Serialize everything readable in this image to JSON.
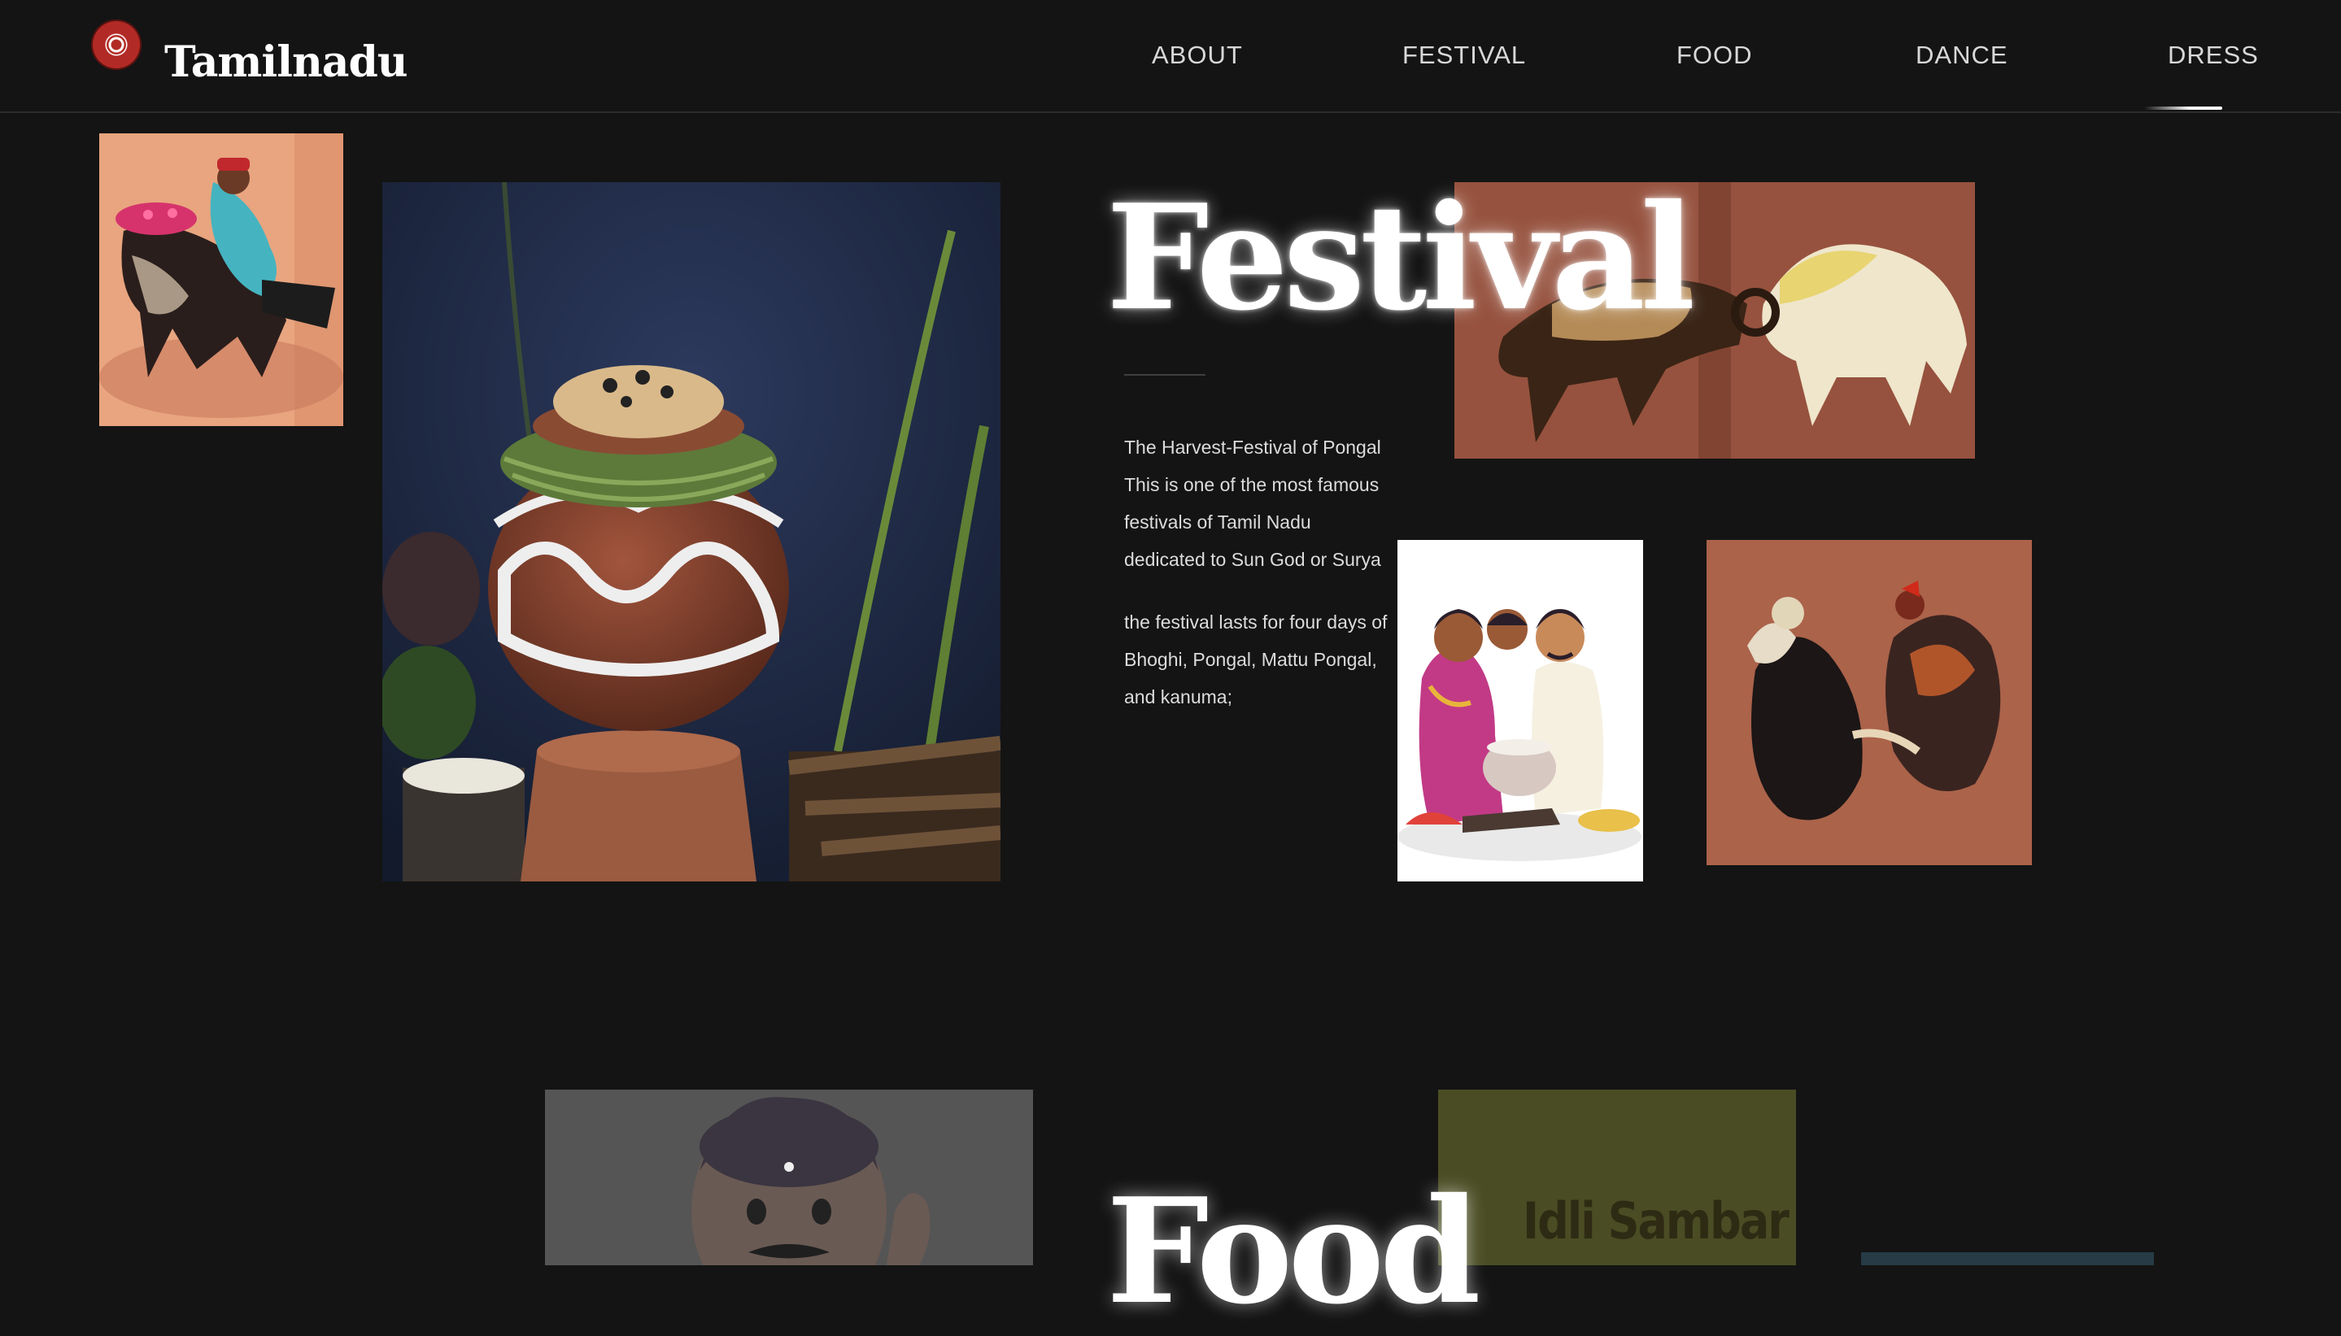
{
  "header": {
    "brand": "Tamilnadu",
    "logo_icon": "emblem-icon",
    "nav": [
      "ABOUT",
      "FESTIVAL",
      "FOOD",
      "DANCE",
      "DRESS"
    ],
    "active_nav": "DRESS"
  },
  "festival": {
    "title": "Festival",
    "para1": [
      "The Harvest-Festival of Pongal",
      "This is one of the most famous",
      "festivals of Tamil Nadu",
      "dedicated to Sun God or Surya"
    ],
    "para2": [
      "the festival lasts for four days of",
      "Bhoghi, Pongal, Mattu Pongal,",
      "and kanuma;"
    ],
    "images": [
      "bull-taming-illustration",
      "pongal-pot-photo",
      "ram-fight-painting",
      "family-cooking-pongal-illustration",
      "rooster-fight-painting"
    ]
  },
  "food": {
    "title": "Food",
    "idli_label": "Idli Sambar",
    "images": [
      "man-eating-illustration",
      "idli-sambar-card",
      "food-card"
    ]
  },
  "colors": {
    "background": "#141414",
    "text": "#e8e8e8",
    "idli_card": "#4a4d24",
    "food_card_teal": "#263b45"
  }
}
